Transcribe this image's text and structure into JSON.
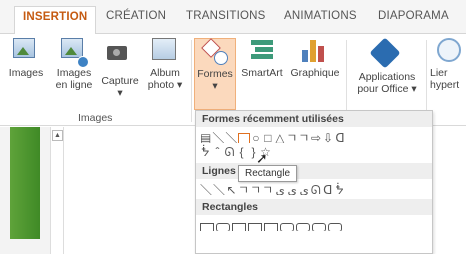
{
  "tabs": [
    {
      "label": "INSERTION",
      "active": true
    },
    {
      "label": "CRÉATION",
      "active": false
    },
    {
      "label": "TRANSITIONS",
      "active": false
    },
    {
      "label": "ANIMATIONS",
      "active": false
    },
    {
      "label": "DIAPORAMA",
      "active": false
    }
  ],
  "ribbon": {
    "images": {
      "label1": "Images",
      "label2": ""
    },
    "images_en_ligne": {
      "label1": "Images",
      "label2": "en ligne"
    },
    "capture": {
      "label1": "Capture",
      "label2": "▾"
    },
    "album": {
      "label1": "Album",
      "label2": "photo ▾"
    },
    "formes": {
      "label1": "Formes",
      "label2": "▾"
    },
    "smartart": {
      "label1": "SmartArt",
      "label2": ""
    },
    "graphique": {
      "label1": "Graphique",
      "label2": ""
    },
    "applications": {
      "label1": "Applications",
      "label2": "pour Office ▾"
    },
    "lien": {
      "label1": "Lier",
      "label2": "hypert"
    },
    "group_images": "Images"
  },
  "dropdown": {
    "recent_header": "Formes récemment utilisées",
    "recent_row1": [
      "▤",
      "＼",
      "＼",
      "",
      "○",
      "□",
      "△",
      "ㄱ",
      "ㄱ",
      "⇨",
      "⇩",
      "ᗡ"
    ],
    "recent_row2": [
      "ᖭ",
      "ˆ",
      "ᘏ",
      "{",
      "}",
      "☆"
    ],
    "lines_header": "Lignes",
    "lines_row": [
      "＼",
      "＼",
      "↖",
      "ㄱ",
      "ㄱ",
      "ㄱ",
      "ﻯ",
      "ﻯ",
      "ﻯ",
      "ᘏ",
      "ᗡ",
      "ᖭ"
    ],
    "rect_header": "Rectangles",
    "tooltip": "Rectangle"
  },
  "colors": {
    "accent": "#c55a11",
    "selected_bg": "#fbd9bd",
    "panel_green": "#4f9a2e"
  }
}
